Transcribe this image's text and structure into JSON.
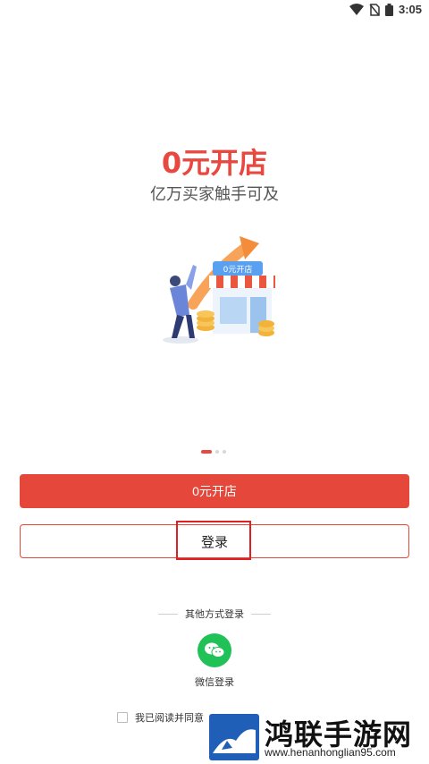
{
  "status_bar": {
    "time": "3:05",
    "icons": [
      "wifi-icon",
      "no-sim-icon",
      "battery-icon"
    ]
  },
  "hero": {
    "title": "0元开店",
    "subtitle": "亿万买家触手可及",
    "illustration_sign": "0元开店"
  },
  "carousel": {
    "pages": 3,
    "active_index": 0
  },
  "actions": {
    "open_store_label": "0元开店",
    "login_label": "登录"
  },
  "other_login": {
    "heading": "其他方式登录",
    "wechat_label": "微信登录"
  },
  "agreement": {
    "text": "我已阅读并同意！"
  },
  "watermark": {
    "title": "鸿联手游网",
    "url": "www.henanhonglian95.com"
  },
  "colors": {
    "accent": "#e5473a",
    "wechat": "#20c157",
    "highlight": "#e02020"
  }
}
